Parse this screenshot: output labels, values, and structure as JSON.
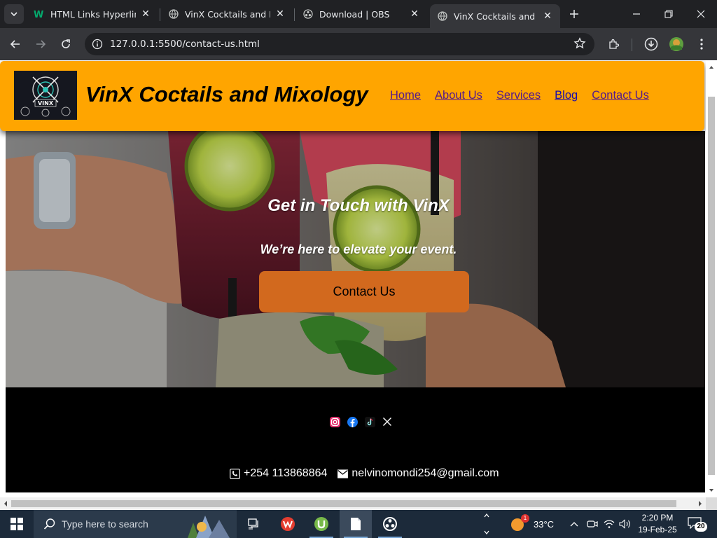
{
  "browser": {
    "tabs": [
      {
        "title": "HTML Links Hyperlinks",
        "icon": "w3schools-icon",
        "active": false
      },
      {
        "title": "VinX Cocktails and Mix",
        "icon": "globe-icon",
        "active": false
      },
      {
        "title": "Download | OBS",
        "icon": "obs-icon",
        "active": false
      },
      {
        "title": "VinX Cocktails and Mix",
        "icon": "globe-icon",
        "active": true
      }
    ],
    "url": "127.0.0.1:5500/contact-us.html"
  },
  "site": {
    "brand": "VinX Coctails and Mixology",
    "logo_text": "VINX",
    "nav": [
      "Home",
      "About Us",
      "Services",
      "Blog",
      "Contact Us"
    ],
    "hero": {
      "title": "Get in Touch with VinX",
      "subtitle": "We’re here to elevate your event.",
      "cta_label": "Contact Us"
    },
    "footer": {
      "socials": [
        "instagram-icon",
        "facebook-icon",
        "tiktok-icon",
        "x-icon"
      ],
      "phone": "+254 113868864",
      "email": "nelvinomondi254@gmail.com"
    },
    "colors": {
      "header": "#ffa500",
      "cta": "#d2691e",
      "footer": "#000000"
    }
  },
  "taskbar": {
    "search_placeholder": "Type here to search",
    "weather": "33°C",
    "weather_badge": "1",
    "time": "2:20 PM",
    "date": "19-Feb-25",
    "notifications": "20"
  }
}
